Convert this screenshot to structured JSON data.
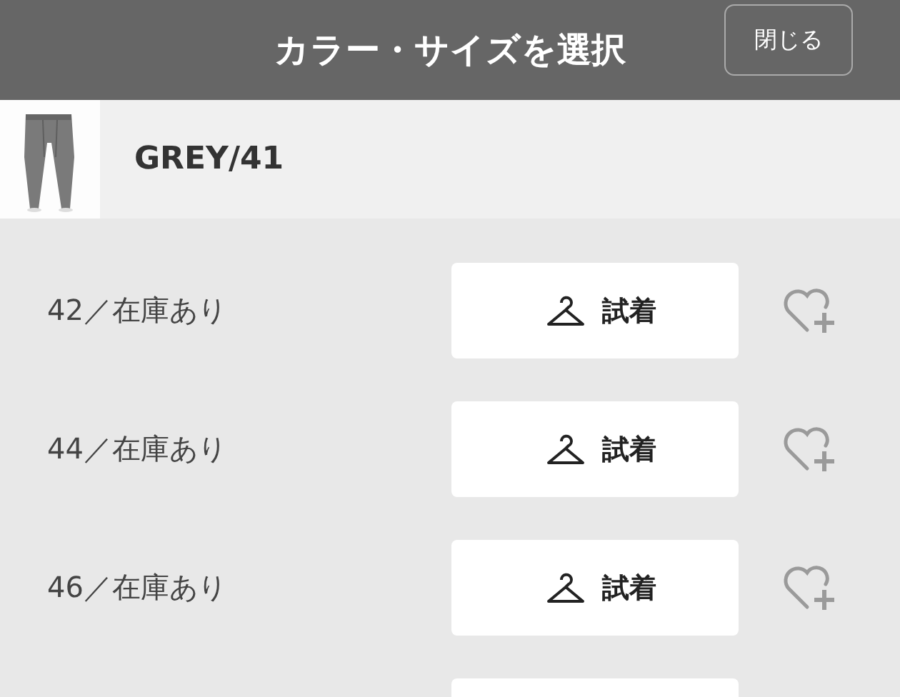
{
  "header": {
    "title": "カラー・サイズを選択",
    "close_button": "閉じる"
  },
  "product": {
    "variant": "GREY/41"
  },
  "sizes": [
    {
      "label": "42／在庫あり",
      "try_on": "試着"
    },
    {
      "label": "44／在庫あり",
      "try_on": "試着"
    },
    {
      "label": "46／在庫あり",
      "try_on": "試着"
    }
  ],
  "more_rows_below": true
}
